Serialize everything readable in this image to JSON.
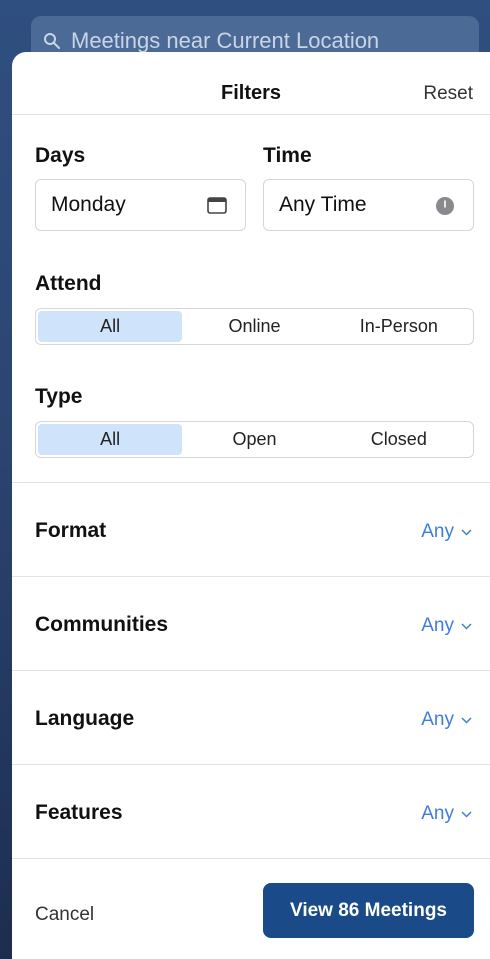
{
  "search": {
    "text": "Meetings near Current Location"
  },
  "header": {
    "title": "Filters",
    "reset_label": "Reset"
  },
  "days": {
    "label": "Days",
    "value": "Monday"
  },
  "time": {
    "label": "Time",
    "value": "Any Time"
  },
  "attend": {
    "label": "Attend",
    "options": [
      "All",
      "Online",
      "In-Person"
    ],
    "selected": "All"
  },
  "type": {
    "label": "Type",
    "options": [
      "All",
      "Open",
      "Closed"
    ],
    "selected": "All"
  },
  "rows": [
    {
      "label": "Format",
      "value": "Any"
    },
    {
      "label": "Communities",
      "value": "Any"
    },
    {
      "label": "Language",
      "value": "Any"
    },
    {
      "label": "Features",
      "value": "Any"
    }
  ],
  "footer": {
    "cancel_label": "Cancel",
    "view_label": "View 86 Meetings"
  },
  "colors": {
    "accent": "#3f7ed8",
    "primary_button": "#1a4a88",
    "segment_selected": "#cfe4fb",
    "background": "#2b4571"
  },
  "icons": {
    "search": "search-icon",
    "calendar": "calendar-icon",
    "clock": "clock-icon",
    "chevron": "chevron-down-icon"
  }
}
